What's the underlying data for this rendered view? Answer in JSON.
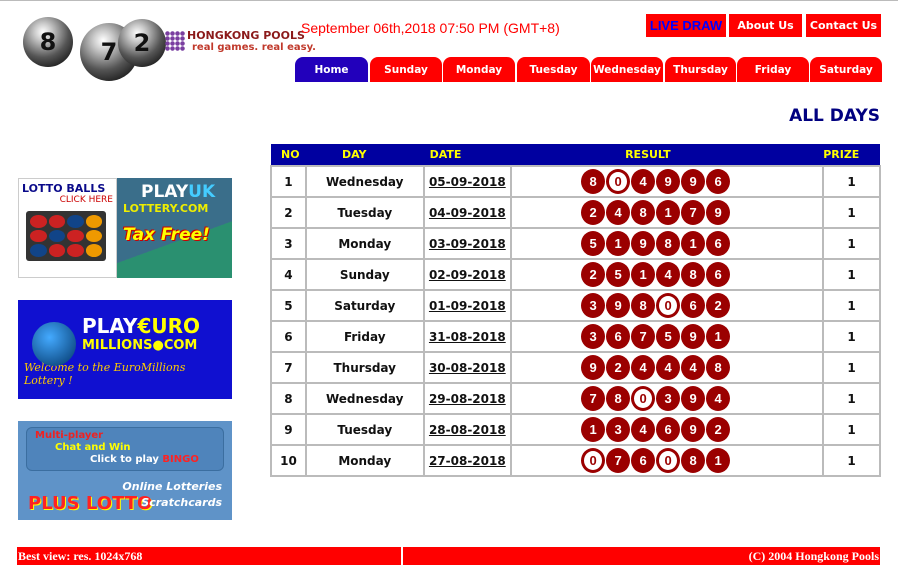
{
  "logo": {
    "balls": [
      "8",
      "7",
      "2"
    ],
    "brand": "HONGKONG POOLS",
    "tagline": "real games. real easy."
  },
  "header": {
    "datetime": "September 06th,2018 07:50 PM (GMT+8)",
    "live_draw": "LIVE DRAW",
    "about": "About Us",
    "contact": "Contact Us"
  },
  "tabs": [
    "Home",
    "Sunday",
    "Monday",
    "Tuesday",
    "Wednesday",
    "Thursday",
    "Friday",
    "Saturday"
  ],
  "page_title": "ALL DAYS",
  "table": {
    "headers": [
      "NO",
      "DAY",
      "DATE",
      "RESULT",
      "PRIZE"
    ],
    "rows": [
      {
        "no": "1",
        "day": "Wednesday",
        "date": "05-09-2018",
        "result": [
          "8",
          "0",
          "4",
          "9",
          "9",
          "6"
        ],
        "prize": "1"
      },
      {
        "no": "2",
        "day": "Tuesday",
        "date": "04-09-2018",
        "result": [
          "2",
          "4",
          "8",
          "1",
          "7",
          "9"
        ],
        "prize": "1"
      },
      {
        "no": "3",
        "day": "Monday",
        "date": "03-09-2018",
        "result": [
          "5",
          "1",
          "9",
          "8",
          "1",
          "6"
        ],
        "prize": "1"
      },
      {
        "no": "4",
        "day": "Sunday",
        "date": "02-09-2018",
        "result": [
          "2",
          "5",
          "1",
          "4",
          "8",
          "6"
        ],
        "prize": "1"
      },
      {
        "no": "5",
        "day": "Saturday",
        "date": "01-09-2018",
        "result": [
          "3",
          "9",
          "8",
          "0",
          "6",
          "2"
        ],
        "prize": "1"
      },
      {
        "no": "6",
        "day": "Friday",
        "date": "31-08-2018",
        "result": [
          "3",
          "6",
          "7",
          "5",
          "9",
          "1"
        ],
        "prize": "1"
      },
      {
        "no": "7",
        "day": "Thursday",
        "date": "30-08-2018",
        "result": [
          "9",
          "2",
          "4",
          "4",
          "4",
          "8"
        ],
        "prize": "1"
      },
      {
        "no": "8",
        "day": "Wednesday",
        "date": "29-08-2018",
        "result": [
          "7",
          "8",
          "0",
          "3",
          "9",
          "4"
        ],
        "prize": "1"
      },
      {
        "no": "9",
        "day": "Tuesday",
        "date": "28-08-2018",
        "result": [
          "1",
          "3",
          "4",
          "6",
          "9",
          "2"
        ],
        "prize": "1"
      },
      {
        "no": "10",
        "day": "Monday",
        "date": "27-08-2018",
        "result": [
          "0",
          "7",
          "6",
          "0",
          "8",
          "1"
        ],
        "prize": "1"
      }
    ]
  },
  "ads": {
    "lotto_balls": {
      "title": "LOTTO BALLS",
      "cta": "CLICK HERE"
    },
    "playuk": {
      "play": "PLAY",
      "uk": "UK",
      "site": "LOTTERY.COM",
      "slogan": "Tax Free!"
    },
    "euro": {
      "play": "PLAY",
      "euro": "€URO",
      "site": "MILLIONS●COM",
      "welcome": "Welcome to the EuroMillions Lottery !"
    },
    "plus": {
      "line1": "Multi-player",
      "line2": "Chat and Win",
      "line3": "Click to play",
      "bingo": "BINGO",
      "lotto": "PLUS LOTTO",
      "online": "Online Lotteries",
      "scratch": "Scratchcards"
    }
  },
  "footer": {
    "left": "Best view: res. 1024x768",
    "right": "(C) 2004 Hongkong Pools"
  },
  "colors": {
    "red": "#ff0000",
    "navy": "#0000a0",
    "ball": "#9b0000",
    "header_text": "#ffff00",
    "home_tab": "#2200bb"
  }
}
